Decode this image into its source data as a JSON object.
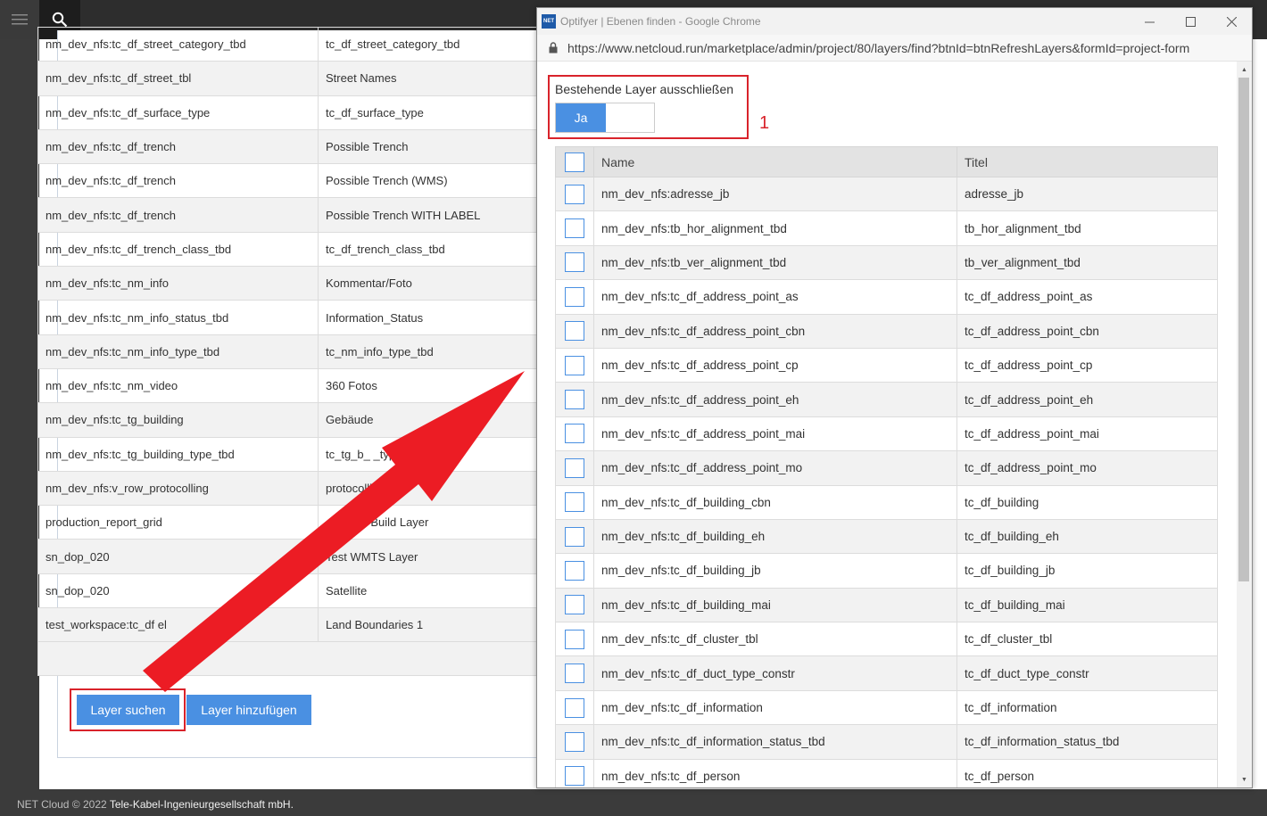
{
  "app": {
    "footer_prefix": "NET Cloud © 2022",
    "footer_company": "Tele-Kabel-Ingenieurgesellschaft mbH."
  },
  "background_table": {
    "rows": [
      [
        "nm_dev_nfs:tc_df_street_category_tbd",
        "tc_df_street_category_tbd"
      ],
      [
        "nm_dev_nfs:tc_df_street_tbl",
        "Street Names"
      ],
      [
        "nm_dev_nfs:tc_df_surface_type",
        "tc_df_surface_type"
      ],
      [
        "nm_dev_nfs:tc_df_trench",
        "Possible Trench"
      ],
      [
        "nm_dev_nfs:tc_df_trench",
        "Possible Trench (WMS)"
      ],
      [
        "nm_dev_nfs:tc_df_trench",
        "Possible Trench WITH LABEL"
      ],
      [
        "nm_dev_nfs:tc_df_trench_class_tbd",
        "tc_df_trench_class_tbd"
      ],
      [
        "nm_dev_nfs:tc_nm_info",
        "Kommentar/Foto"
      ],
      [
        "nm_dev_nfs:tc_nm_info_status_tbd",
        "Information_Status"
      ],
      [
        "nm_dev_nfs:tc_nm_info_type_tbd",
        "tc_nm_info_type_tbd"
      ],
      [
        "nm_dev_nfs:tc_nm_video",
        "360 Fotos"
      ],
      [
        "nm_dev_nfs:tc_tg_building",
        "Gebäude"
      ],
      [
        "nm_dev_nfs:tc_tg_building_type_tbd",
        "tc_tg_b_ _type_tbd"
      ],
      [
        "nm_dev_nfs:v_row_protocolling",
        "protocolling"
      ],
      [
        "production_report_grid",
        "est NET Build Layer"
      ],
      [
        "sn_dop_020",
        "Test WMTS Layer"
      ],
      [
        "sn_dop_020",
        "Satellite"
      ],
      [
        "test_workspace:tc_df el",
        "Land Boundaries 1"
      ]
    ],
    "search_button": "Layer suchen",
    "add_button": "Layer hinzufügen"
  },
  "popup": {
    "window_title": "Optifyer | Ebenen finden - Google Chrome",
    "logo_text": "NET",
    "url": "https://www.netcloud.run/marketplace/admin/project/80/layers/find?btnId=btnRefreshLayers&formId=project-form",
    "exclude_label": "Bestehende Layer ausschließen",
    "toggle_on": "Ja",
    "annotation_number": "1",
    "columns": [
      "Name",
      "Titel"
    ],
    "layers": [
      [
        "nm_dev_nfs:adresse_jb",
        "adresse_jb"
      ],
      [
        "nm_dev_nfs:tb_hor_alignment_tbd",
        "tb_hor_alignment_tbd"
      ],
      [
        "nm_dev_nfs:tb_ver_alignment_tbd",
        "tb_ver_alignment_tbd"
      ],
      [
        "nm_dev_nfs:tc_df_address_point_as",
        "tc_df_address_point_as"
      ],
      [
        "nm_dev_nfs:tc_df_address_point_cbn",
        "tc_df_address_point_cbn"
      ],
      [
        "nm_dev_nfs:tc_df_address_point_cp",
        "tc_df_address_point_cp"
      ],
      [
        "nm_dev_nfs:tc_df_address_point_eh",
        "tc_df_address_point_eh"
      ],
      [
        "nm_dev_nfs:tc_df_address_point_mai",
        "tc_df_address_point_mai"
      ],
      [
        "nm_dev_nfs:tc_df_address_point_mo",
        "tc_df_address_point_mo"
      ],
      [
        "nm_dev_nfs:tc_df_building_cbn",
        "tc_df_building"
      ],
      [
        "nm_dev_nfs:tc_df_building_eh",
        "tc_df_building_eh"
      ],
      [
        "nm_dev_nfs:tc_df_building_jb",
        "tc_df_building_jb"
      ],
      [
        "nm_dev_nfs:tc_df_building_mai",
        "tc_df_building_mai"
      ],
      [
        "nm_dev_nfs:tc_df_cluster_tbl",
        "tc_df_cluster_tbl"
      ],
      [
        "nm_dev_nfs:tc_df_duct_type_constr",
        "tc_df_duct_type_constr"
      ],
      [
        "nm_dev_nfs:tc_df_information",
        "tc_df_information"
      ],
      [
        "nm_dev_nfs:tc_df_information_status_tbd",
        "tc_df_information_status_tbd"
      ],
      [
        "nm_dev_nfs:tc_df_person",
        "tc_df_person"
      ]
    ]
  },
  "colors": {
    "accent": "#4a90e2",
    "annotation_red": "#d9232b",
    "arrow_red": "#ec1c24"
  },
  "icons": [
    "hamburger-menu-icon",
    "search-icon",
    "lock-icon",
    "minimize-icon",
    "maximize-icon",
    "close-icon",
    "arrow-annotation"
  ]
}
